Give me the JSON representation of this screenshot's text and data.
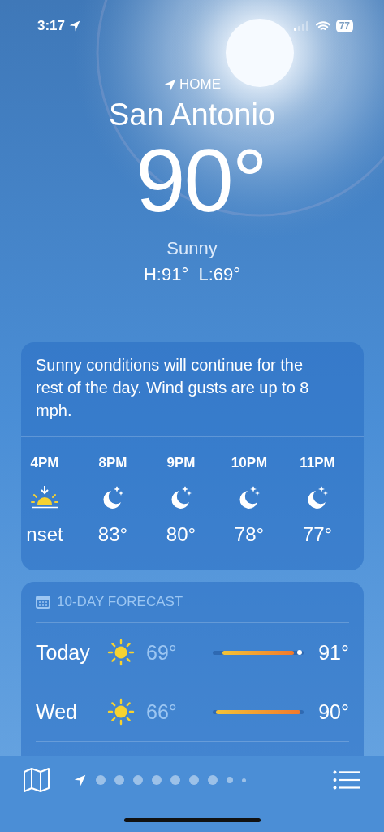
{
  "status_bar": {
    "time": "3:17",
    "battery": "77"
  },
  "header": {
    "label": "HOME",
    "city": "San Antonio",
    "temperature": "90°",
    "condition": "Sunny",
    "high_low": "H:91°  L:69°"
  },
  "hourly": {
    "summary": "Sunny conditions will continue for the rest of the day. Wind gusts are up to 8 mph.",
    "items": [
      {
        "time": "4PM",
        "kind": "sunset",
        "value": "nset"
      },
      {
        "time": "8PM",
        "kind": "night",
        "value": "83°"
      },
      {
        "time": "9PM",
        "kind": "night",
        "value": "80°"
      },
      {
        "time": "10PM",
        "kind": "night",
        "value": "78°"
      },
      {
        "time": "11PM",
        "kind": "night",
        "value": "77°"
      }
    ]
  },
  "ten_day": {
    "title": "10-DAY FORECAST",
    "days": [
      {
        "day": "Today",
        "low": "69°",
        "high": "91°",
        "current": true
      },
      {
        "day": "Wed",
        "low": "66°",
        "high": "90°",
        "current": false
      }
    ]
  },
  "page_dots": [
    {
      "kind": "location",
      "selected": true
    },
    {
      "kind": "dot",
      "selected": false
    },
    {
      "kind": "dot",
      "selected": false
    },
    {
      "kind": "dot",
      "selected": false
    },
    {
      "kind": "dot",
      "selected": false
    },
    {
      "kind": "dot",
      "selected": false
    },
    {
      "kind": "dot",
      "selected": false
    },
    {
      "kind": "dot",
      "selected": false
    },
    {
      "kind": "small",
      "selected": false
    },
    {
      "kind": "tiny",
      "selected": false
    }
  ]
}
